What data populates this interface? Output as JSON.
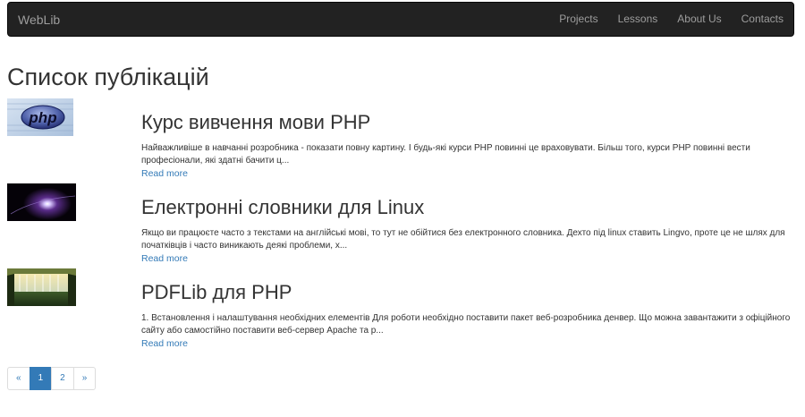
{
  "navbar": {
    "brand": "WebLib",
    "links": [
      "Projects",
      "Lessons",
      "About Us",
      "Contacts"
    ]
  },
  "page_title": "Список публікацій",
  "publications": [
    {
      "thumbnail_icon": "php-logo-thumbnail",
      "title": "Курс вивчення мови PHP",
      "excerpt": "Найважливіше в навчанні розробника - показати повну картину. І будь-які курси PHP повинні це враховувати. Більш того, курси PHP повинні вести професіонали, які здатні бачити ц...",
      "read_more": "Read more"
    },
    {
      "thumbnail_icon": "space-light-thumbnail",
      "title": "Електронні словники для Linux",
      "excerpt": "Якщо ви працюєте часто з текстами на англійські мові, то тут не обійтися без електронного словника. Дехто під linux ставить Lingvo, проте це не шлях для початківців і часто виникають деякі проблеми, х...",
      "read_more": "Read more"
    },
    {
      "thumbnail_icon": "waterfall-thumbnail",
      "title": "PDFLib для PHP",
      "excerpt": "1. Встановлення і налаштування необхідних елементів Для роботи необхідно поставити пакет веб-розробника денвер. Що можна завантажити з офіційного сайту або самостійно поставити веб-сервер Apache та р...",
      "read_more": "Read more"
    }
  ],
  "pagination": {
    "prev": "«",
    "pages": [
      "1",
      "2"
    ],
    "active_page": "1",
    "next": "»"
  },
  "colors": {
    "navbar_bg": "#222222",
    "link": "#337ab7",
    "active_page_bg": "#337ab7"
  }
}
